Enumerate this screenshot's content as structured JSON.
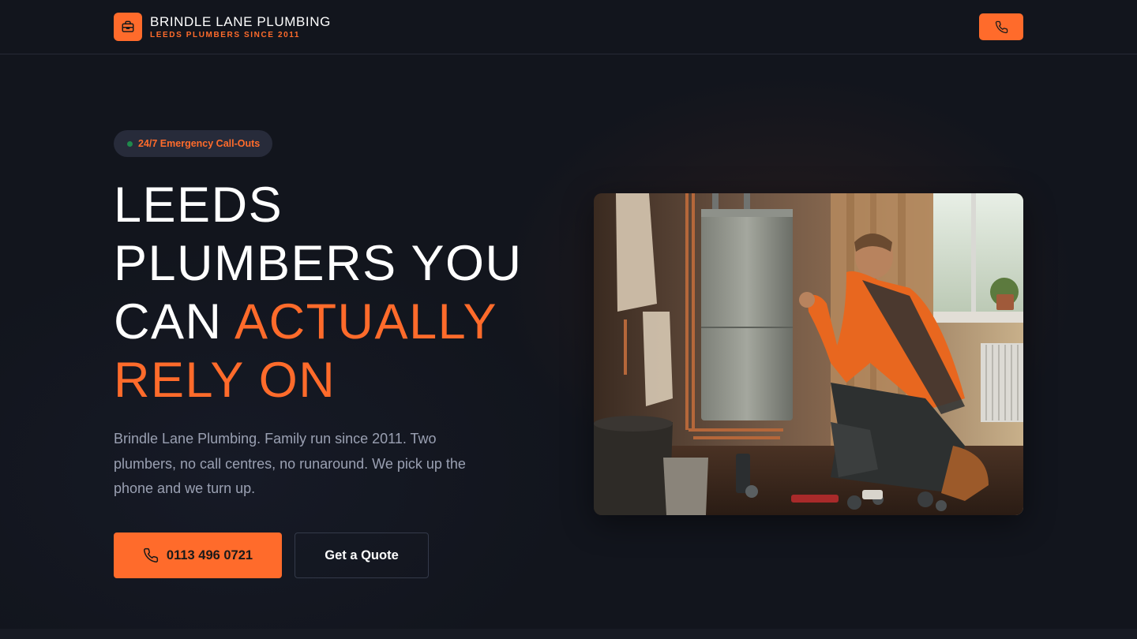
{
  "brand": {
    "name": "BRINDLE LANE PLUMBING",
    "tagline": "LEEDS PLUMBERS SINCE 2011",
    "logo_icon": "toolbox-icon"
  },
  "header": {
    "phone_icon": "phone-icon"
  },
  "hero": {
    "badge": "24/7 Emergency Call-Outs",
    "headline_part1": "LEEDS PLUMBERS YOU CAN ",
    "headline_accent": "ACTUALLY RELY ON",
    "intro": "Brindle Lane Plumbing. Family run since 2011. Two plumbers, no call centres, no runaround. We pick up the phone and we turn up.",
    "call_button": "0113 496 0721",
    "quote_button": "Get a Quote",
    "image_alt": "Plumber in orange shirt kneeling beside a wall-mounted boiler"
  },
  "colors": {
    "accent": "#ff6b2b",
    "background": "#12151d",
    "badge_bg": "#272b3a",
    "status_dot": "#1f8a4c",
    "muted_text": "#9aa0b2"
  }
}
